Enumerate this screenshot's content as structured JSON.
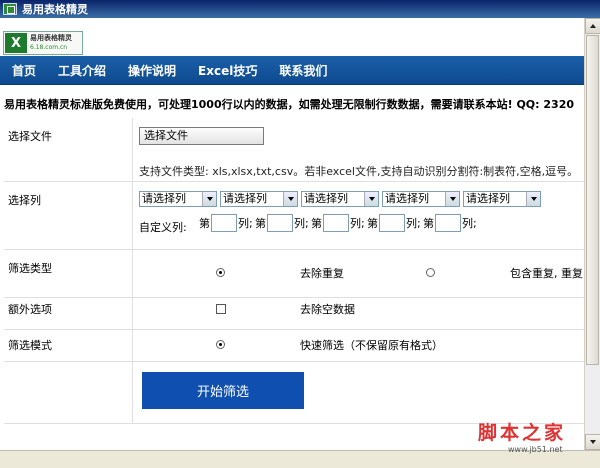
{
  "window": {
    "title": "易用表格精灵"
  },
  "logo": {
    "mark": "X",
    "name": "易用表格精灵",
    "url": "6.18.com.cn"
  },
  "nav": {
    "items": [
      "首页",
      "工具介绍",
      "操作说明",
      "Excel技巧",
      "联系我们"
    ]
  },
  "notice": "易用表格精灵标准版免费使用，可处理1000行以内的数据，如需处理无限制行数数据，需要请联系本站! QQ: 2320",
  "form": {
    "file": {
      "label": "选择文件",
      "button_label": "选择文件",
      "hint": "支持文件类型: xls,xlsx,txt,csv。若非excel文件,支持自动识别分割符:制表符,空格,逗号。"
    },
    "columns": {
      "label": "选择列",
      "selects": [
        "请选择列",
        "请选择列",
        "请选择列",
        "请选择列",
        "请选择列"
      ],
      "custom_label": "自定义列:",
      "custom_prefix": "第",
      "custom_suffix": "列;"
    },
    "filter_type": {
      "label": "筛选类型",
      "options": [
        {
          "label": "去除重复",
          "checked": true
        },
        {
          "label": "包含重复, 重复",
          "checked": false
        }
      ]
    },
    "extra": {
      "label": "额外选项",
      "option_label": "去除空数据",
      "checked": false
    },
    "mode": {
      "label": "筛选模式",
      "option_label": "快速筛选（不保留原有格式）",
      "checked": true
    },
    "start_button_label": "开始筛选"
  },
  "watermark": {
    "text": "脚本之家",
    "url": "www.jb51.net"
  },
  "colors": {
    "nav": "#1b5fa8",
    "button": "#0e4fb0",
    "watermark": "#dd3333"
  }
}
